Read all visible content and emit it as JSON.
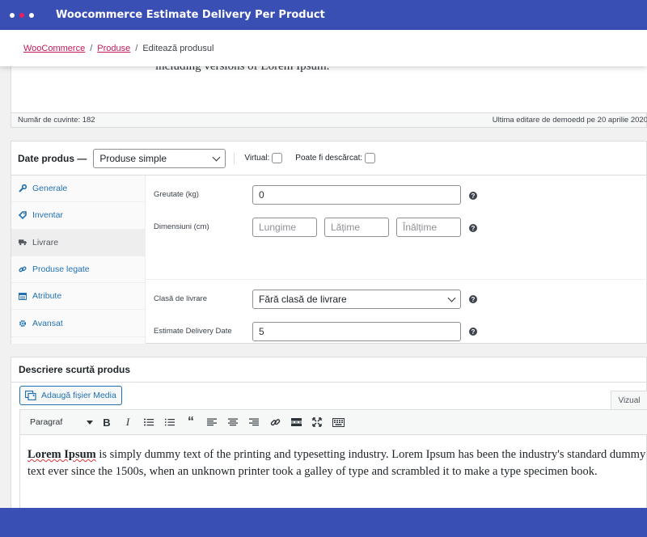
{
  "app": {
    "title": "Woocommerce Estimate Delivery Per Product",
    "dot_colors": [
      "#ffffff",
      "#e91e63",
      "#ffffff"
    ]
  },
  "breadcrumb": {
    "items": [
      "WooCommerce",
      "Produse"
    ],
    "current": "Editează produsul"
  },
  "editor": {
    "clipped_text": "including versions of Lorem Ipsum.",
    "word_count": "Număr de cuvinte: 182",
    "last_edit": "Ultima editare de demoedd pe 20 aprilie 2020"
  },
  "product_data": {
    "title": "Date produs —",
    "type_value": "Produse simple",
    "virtual_label": "Virtual:",
    "downloadable_label": "Poate fi descărcat:",
    "tabs": [
      {
        "label": "Generale",
        "icon": "wrench-icon"
      },
      {
        "label": "Inventar",
        "icon": "tag-icon"
      },
      {
        "label": "Livrare",
        "icon": "truck-icon"
      },
      {
        "label": "Produse legate",
        "icon": "link-icon"
      },
      {
        "label": "Atribute",
        "icon": "table-icon"
      },
      {
        "label": "Avansat",
        "icon": "gear-icon"
      }
    ],
    "weight_label": "Greutate (kg)",
    "weight_value": "0",
    "dimensions_label": "Dimensiuni (cm)",
    "length_placeholder": "Lungime",
    "width_placeholder": "Lățime",
    "height_placeholder": "Înălțime",
    "shipping_class_label": "Clasă de livrare",
    "shipping_class_value": "Fără clasă de livrare",
    "delivery_label": "Estimate Delivery Date",
    "delivery_value": "5"
  },
  "short_description": {
    "title": "Descriere scurtă produs",
    "add_media": "Adaugă fișier Media",
    "visual_tab": "Vizual",
    "paragraph": "Paragraf",
    "content": {
      "bold": "Lorem Ipsum",
      "text": "is simply dummy text of the printing and typesetting industry. Lorem Ipsum has been the industry's standard dummy text ever since the 1500s, when an unknown printer took a galley of type and scrambled it to make a type specimen book."
    }
  },
  "colors": {
    "header_bg": "#3a4fb4",
    "link": "#2271b1",
    "breadcrumb_link": "#c2185b"
  }
}
